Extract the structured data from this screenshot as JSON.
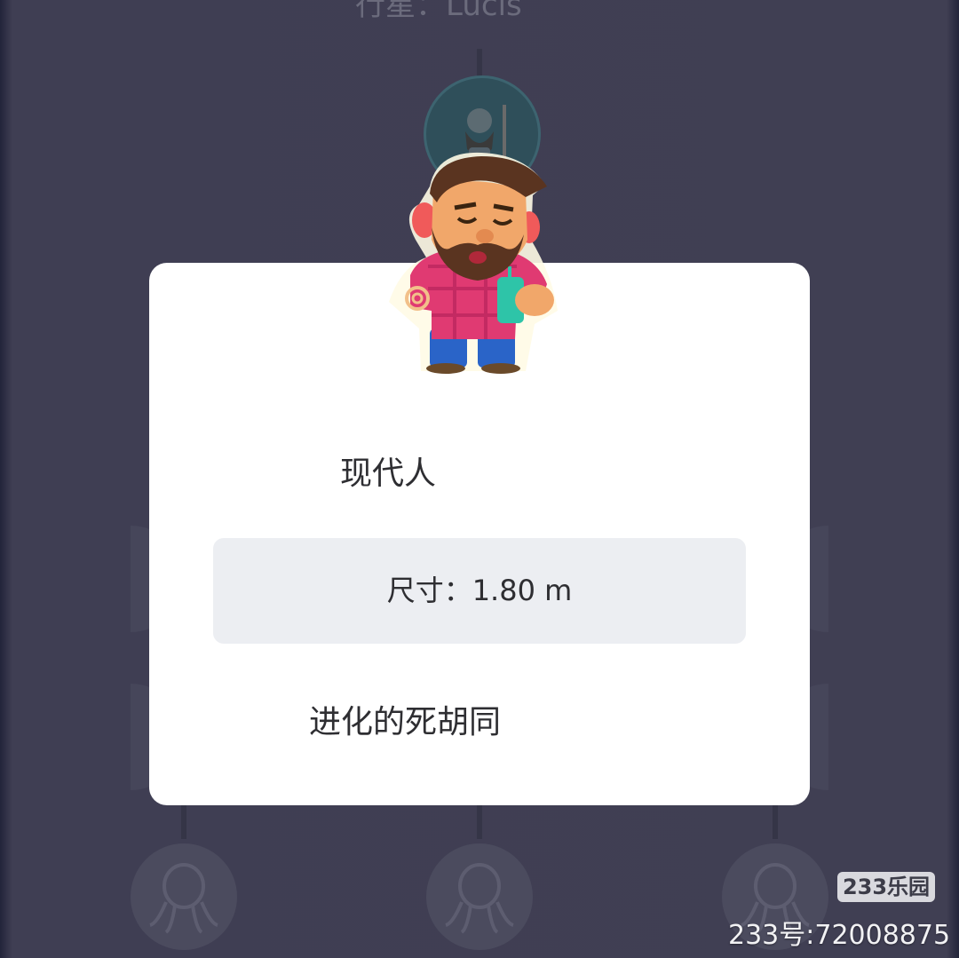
{
  "background": {
    "title_partial": "行星：Lucis",
    "node_icons": [
      "caveman-icon",
      "octopus-icon",
      "octopus-icon",
      "octopus-icon"
    ]
  },
  "dialog": {
    "character_icon": "bearded-modern-man-icon",
    "species_name": "现代人",
    "size_label": "尺寸：1.80 m",
    "description": "进化的死胡同"
  },
  "watermark": {
    "logo": "233乐园",
    "id": "233号:72008875"
  },
  "colors": {
    "overlay": "#403f53",
    "dialog": "#ffffff",
    "size_box": "#eceef2",
    "text": "#2e2e32"
  }
}
